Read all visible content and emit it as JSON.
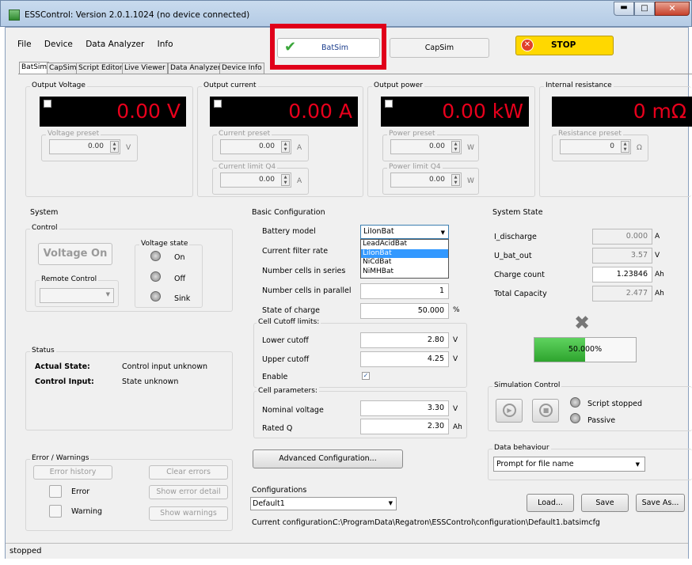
{
  "window": {
    "title": "ESSControl: Version 2.0.1.1024 (no device connected)",
    "status": "stopped"
  },
  "menu": [
    "File",
    "Device",
    "Data Analyzer",
    "Info"
  ],
  "toolbar": {
    "batsim": "BatSim",
    "capsim": "CapSim",
    "stop": "STOP"
  },
  "tabs": [
    "BatSim",
    "CapSim",
    "Script Editor",
    "Live Viewer",
    "Data Analyzer",
    "Device Info"
  ],
  "panels": [
    {
      "title": "Output Voltage",
      "value": "0.00 V",
      "preset_label": "Voltage preset",
      "preset": "0.00",
      "unit": "V"
    },
    {
      "title": "Output current",
      "value": "0.00 A",
      "preset_label": "Current preset",
      "preset": "0.00",
      "unit": "A",
      "limit_label": "Current limit Q4",
      "limit": "0.00",
      "limit_unit": "A"
    },
    {
      "title": "Output power",
      "value": "0.00 kW",
      "preset_label": "Power preset",
      "preset": "0.00",
      "unit": "W",
      "limit_label": "Power limit Q4",
      "limit": "0.00",
      "limit_unit": "W"
    },
    {
      "title": "Internal resistance",
      "value": "0 mΩ",
      "preset_label": "Resistance preset",
      "preset": "0",
      "unit": "Ω"
    }
  ],
  "system": {
    "title": "System",
    "control": "Control",
    "voltage_on": "Voltage On",
    "voltage_state": "Voltage state",
    "states": [
      "On",
      "Off",
      "Sink"
    ],
    "remote": "Remote Control",
    "status": "Status",
    "actual_state_label": "Actual State:",
    "actual_state": "Control input unknown",
    "control_input_label": "Control Input:",
    "control_input": "State unknown",
    "errors": "Error / Warnings",
    "error_history": "Error history",
    "clear_errors": "Clear errors",
    "error": "Error",
    "show_error_detail": "Show error detail",
    "warning": "Warning",
    "show_warnings": "Show warnings"
  },
  "basic": {
    "title": "Basic Configuration",
    "battery_model_label": "Battery model",
    "battery_model": "LiIonBat",
    "options": [
      "LeadAcidBat",
      "LiIonBat",
      "NiCdBat",
      "NiMHBat"
    ],
    "filter_label": "Current filter rate",
    "series_label": "Number cells in series",
    "parallel_label": "Number cells in parallel",
    "parallel": "1",
    "soc_label": "State of charge",
    "soc": "50.000",
    "soc_unit": "%",
    "cutoff_title": "Cell Cutoff limits:",
    "lower_label": "Lower cutoff",
    "lower": "2.80",
    "upper_label": "Upper cutoff",
    "upper": "4.25",
    "volt_unit": "V",
    "enable_label": "Enable",
    "params_title": "Cell parameters:",
    "nominal_label": "Nominal voltage",
    "nominal": "3.30",
    "rated_label": "Rated Q",
    "rated": "2.30",
    "ah_unit": "Ah",
    "advanced": "Advanced Configuration..."
  },
  "configs": {
    "title": "Configurations",
    "selected": "Default1",
    "load": "Load...",
    "save": "Save",
    "save_as": "Save As...",
    "current_label": "Current configuration:",
    "path": "C:\\ProgramData\\Regatron\\ESSControl\\configuration\\Default1.batsimcfg"
  },
  "sysstate": {
    "title": "System State",
    "rows": [
      {
        "label": "I_discharge",
        "value": "0.000",
        "unit": "A"
      },
      {
        "label": "U_bat_out",
        "value": "3.57",
        "unit": "V"
      },
      {
        "label": "Charge count",
        "value": "1.23846",
        "unit": "Ah"
      },
      {
        "label": "Total Capacity",
        "value": "2.477",
        "unit": "Ah"
      }
    ],
    "progress_text": "50.000%",
    "progress": 0.5
  },
  "sim": {
    "title": "Simulation Control",
    "script": "Script stopped",
    "passive": "Passive"
  },
  "data": {
    "title": "Data behaviour",
    "selected": "Prompt for file name"
  },
  "colors": {
    "display_red": "#e8001c",
    "stop_bg": "#ffd800",
    "highlight": "#e0001a",
    "progress": "#3cb83c",
    "selection": "#3399ff"
  }
}
